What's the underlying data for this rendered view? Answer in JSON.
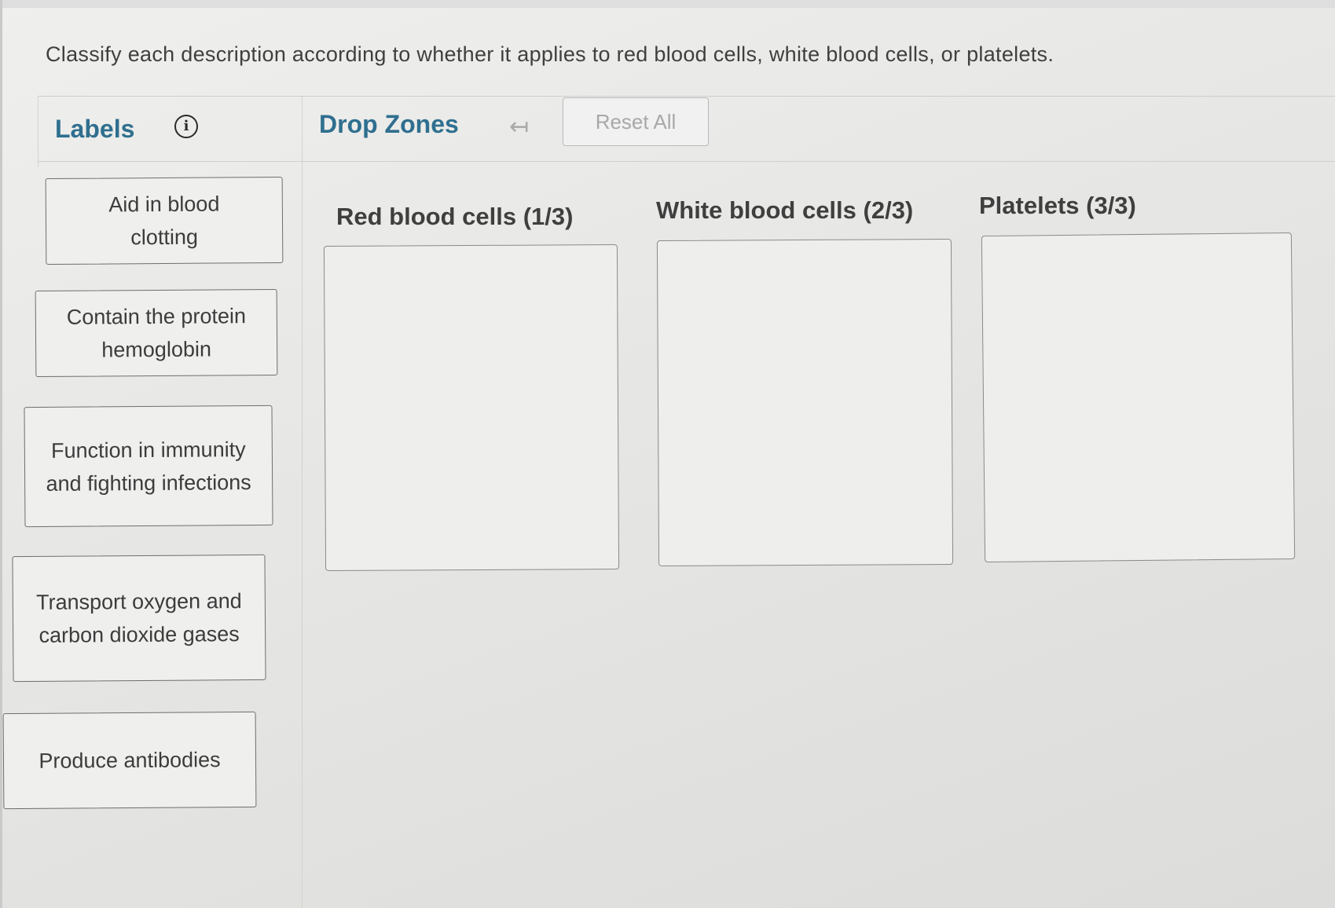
{
  "instruction": "Classify each description according to whether it applies to red blood cells, white blood cells, or platelets.",
  "labels_panel": {
    "header": "Labels",
    "info_icon": "i",
    "items": [
      {
        "label": "Aid in blood clotting"
      },
      {
        "label": "Contain the protein hemoglobin"
      },
      {
        "label": "Function in immunity and fighting infections"
      },
      {
        "label": "Transport oxygen and carbon dioxide gases"
      },
      {
        "label": "Produce antibodies"
      }
    ]
  },
  "drop_zones_panel": {
    "header": "Drop Zones",
    "undo_icon": "↤",
    "reset_label": "Reset All",
    "zones": [
      {
        "title": "Red blood cells (1/3)"
      },
      {
        "title": "White blood cells (2/3)"
      },
      {
        "title": "Platelets (3/3)"
      }
    ]
  },
  "colors": {
    "header_accent": "#2f6f8f",
    "background": "#e8e8e6"
  }
}
